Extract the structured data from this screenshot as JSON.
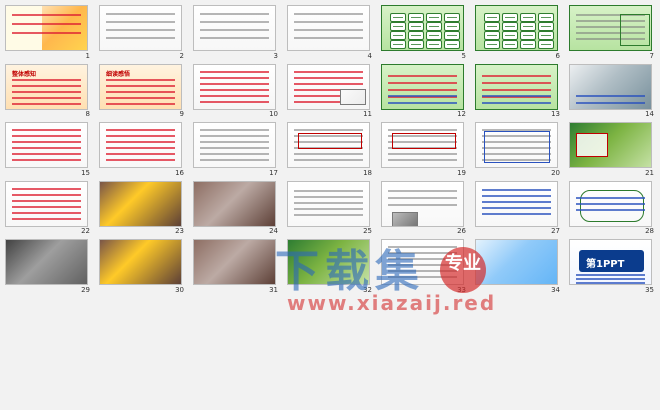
{
  "slides": [
    {
      "num": "1"
    },
    {
      "num": "2"
    },
    {
      "num": "3"
    },
    {
      "num": "4"
    },
    {
      "num": "5"
    },
    {
      "num": "6"
    },
    {
      "num": "7"
    },
    {
      "num": "8"
    },
    {
      "num": "9"
    },
    {
      "num": "10"
    },
    {
      "num": "11"
    },
    {
      "num": "12"
    },
    {
      "num": "13"
    },
    {
      "num": "14"
    },
    {
      "num": "15"
    },
    {
      "num": "16"
    },
    {
      "num": "17"
    },
    {
      "num": "18"
    },
    {
      "num": "19"
    },
    {
      "num": "20"
    },
    {
      "num": "21"
    },
    {
      "num": "22"
    },
    {
      "num": "23"
    },
    {
      "num": "24"
    },
    {
      "num": "25"
    },
    {
      "num": "26"
    },
    {
      "num": "27"
    },
    {
      "num": "28"
    },
    {
      "num": "29"
    },
    {
      "num": "30"
    },
    {
      "num": "31"
    },
    {
      "num": "32"
    },
    {
      "num": "33"
    },
    {
      "num": "34"
    },
    {
      "num": "35"
    }
  ],
  "slide8": {
    "title": "整体感知"
  },
  "slide9": {
    "title": "细读感悟"
  },
  "watermark": {
    "main": "下载集",
    "site": "www.xiazaij.red",
    "badge": "专业"
  },
  "slide35": {
    "logo": "第1PPT"
  }
}
